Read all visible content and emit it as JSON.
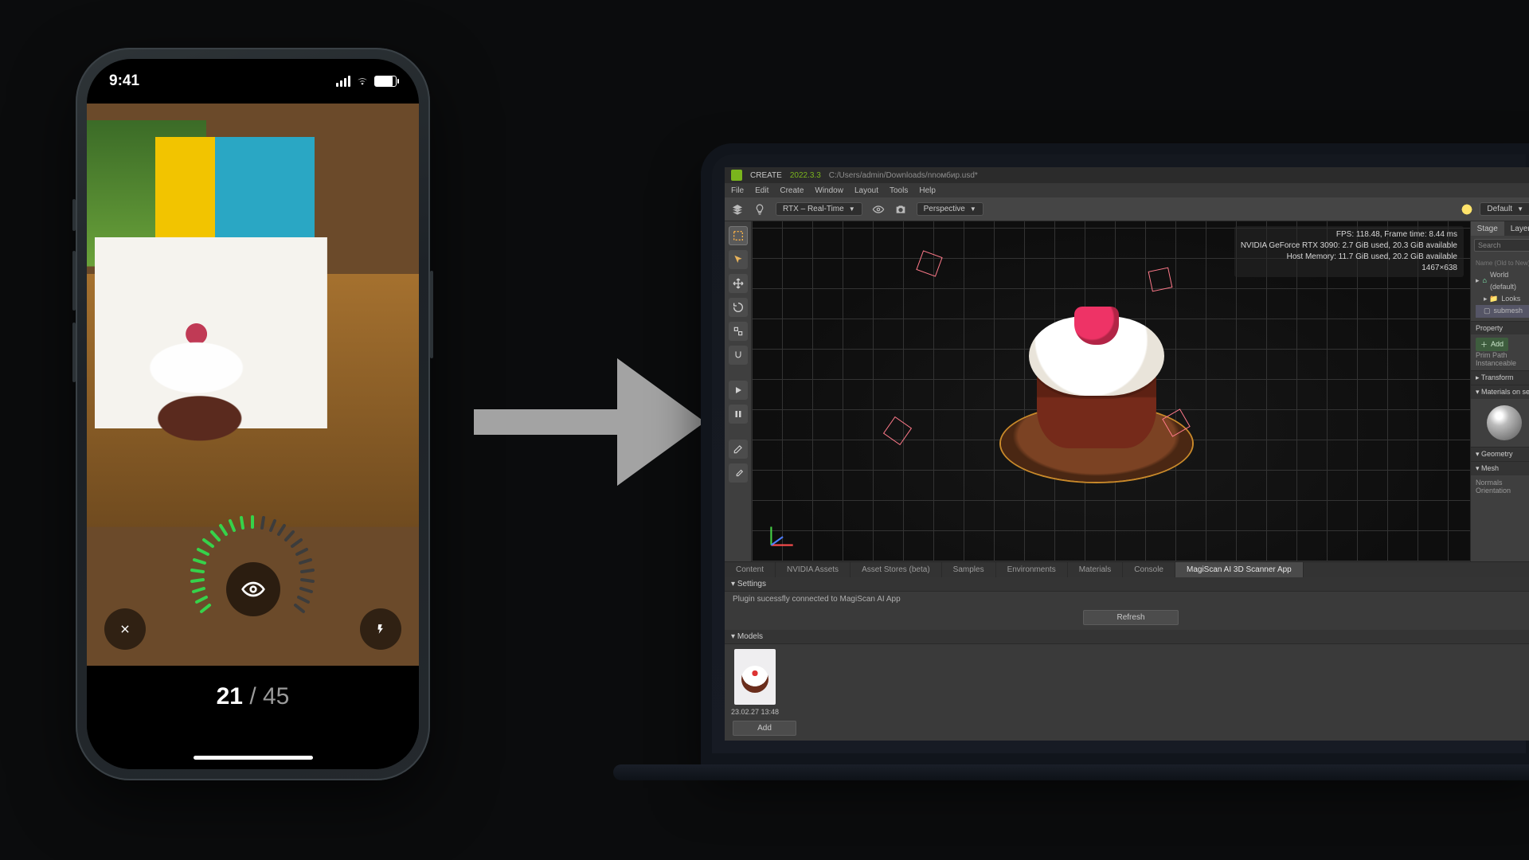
{
  "phone": {
    "status": {
      "time": "9:41"
    },
    "capture": {
      "current": "21",
      "total": "45"
    }
  },
  "arrow": "→",
  "app": {
    "title": "CREATE",
    "version": "2022.3.3",
    "filepath": "C:/Users/admin/Downloads/nnoмбиp.usd*",
    "menus": [
      "File",
      "Edit",
      "Create",
      "Window",
      "Layout",
      "Tools",
      "Help"
    ],
    "toolbar": {
      "renderer": "RTX – Real-Time",
      "camera": "Perspective",
      "shading": "Default"
    },
    "viewport_stats": {
      "line1": "FPS: 118.48, Frame time: 8.44 ms",
      "line2": "NVIDIA GeForce RTX 3090: 2.7 GiB used, 20.3 GiB available",
      "line3": "Host Memory: 11.7 GiB used, 20.2 GiB available",
      "line4": "1467×638"
    },
    "stage": {
      "tab_stage": "Stage",
      "tab_layer": "Layer",
      "search_ph": "Search",
      "col_hdr": "Name (Old to New)",
      "world": "World (default)",
      "looks": "Looks",
      "submesh": "submesh"
    },
    "property": {
      "title": "Property",
      "add": "Add",
      "prim": "Prim Path",
      "inst": "Instanceable",
      "transform": "Transform",
      "materials": "Materials on sel",
      "geometry": "Geometry",
      "mesh": "Mesh",
      "normals": "Normals",
      "orientation": "Orientation"
    },
    "tabs": {
      "content": "Content",
      "nvidia": "NVIDIA Assets",
      "stores": "Asset Stores (beta)",
      "samples": "Samples",
      "env": "Environments",
      "materials": "Materials",
      "console": "Console",
      "magiscan": "MagiScan AI 3D Scanner App"
    },
    "plugin": {
      "settings": "Settings",
      "status": "Plugin sucessfly connected to MagiScan AI App",
      "refresh": "Refresh",
      "models": "Models",
      "thumb_caption": "23.02.27 13:48",
      "add": "Add"
    }
  }
}
